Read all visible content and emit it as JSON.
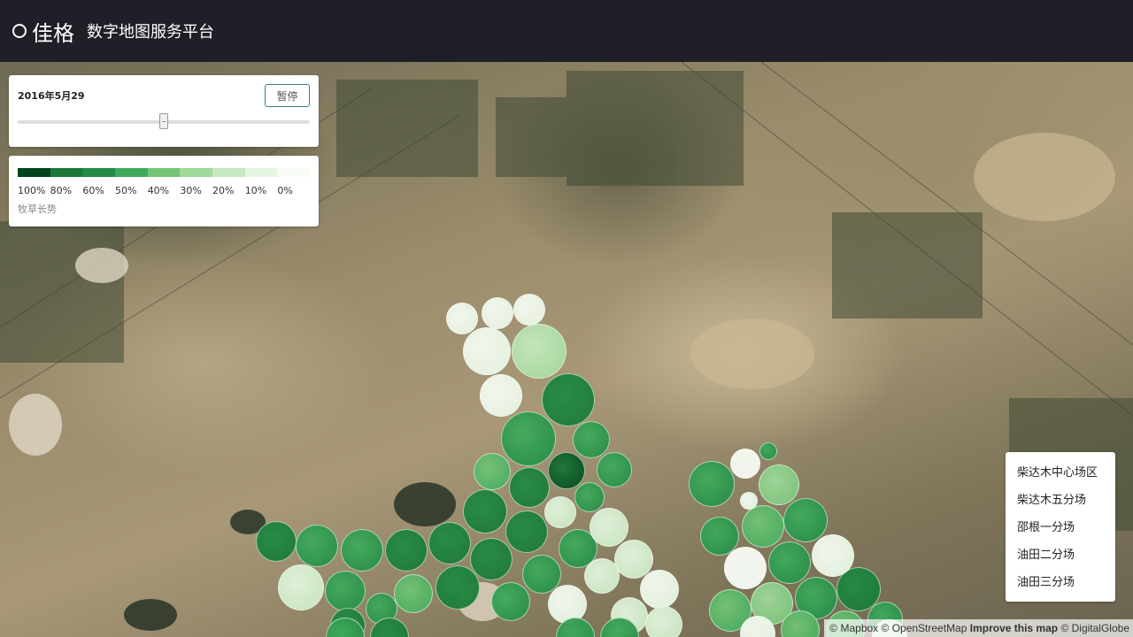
{
  "header": {
    "brand": "佳格",
    "platform_title": "数字地图服务平台"
  },
  "timeline": {
    "date_label": "2016年5月29",
    "pause_label": "暂停",
    "progress": 0.5
  },
  "legend": {
    "colors": [
      "#00441b",
      "#1b7837",
      "#238b45",
      "#41ab5d",
      "#74c476",
      "#a1d99b",
      "#c7e9c0",
      "#e5f5e0",
      "#f7fcf5"
    ],
    "ticks": [
      "100%",
      "80%",
      "60%",
      "50%",
      "40%",
      "30%",
      "20%",
      "10%",
      "0%"
    ],
    "title": "牧草长势"
  },
  "farm_list": {
    "items": [
      "柴达木中心场区",
      "柴达木五分场",
      "邵根一分场",
      "油田二分场",
      "油田三分场"
    ]
  },
  "attribution": {
    "mapbox": "© Mapbox",
    "osm": "© OpenStreetMap",
    "improve": "Improve this map",
    "digitalglobe": "© DigitalGlobe"
  },
  "fields": [
    {
      "level": 0.1
    },
    {
      "level": 0.1
    },
    {
      "level": 0.1
    },
    {
      "level": 0.15
    },
    {
      "level": 0.4
    },
    {
      "level": 0.15
    },
    {
      "level": 0.9
    },
    {
      "level": 0.75
    },
    {
      "level": 0.8
    },
    {
      "level": 0.65
    },
    {
      "level": 0.9
    },
    {
      "level": 0.95
    },
    {
      "level": 0.75
    },
    {
      "level": 0.85
    },
    {
      "level": 0.9
    },
    {
      "level": 0.2
    },
    {
      "level": 0.75
    },
    {
      "level": 0.85
    },
    {
      "level": 0.7
    },
    {
      "level": 0.7
    },
    {
      "level": 0.3
    },
    {
      "level": 0.2
    },
    {
      "level": 0.1
    },
    {
      "level": 0.9
    },
    {
      "level": 0.8
    },
    {
      "level": 0.7
    },
    {
      "level": 0.85
    },
    {
      "level": 0.9
    },
    {
      "level": 0.9
    },
    {
      "level": 0.6
    },
    {
      "level": 0.3
    },
    {
      "level": 0.7
    },
    {
      "level": 0.8
    },
    {
      "level": 0.9
    },
    {
      "level": 0.75
    },
    {
      "level": 0.15
    },
    {
      "level": 0.3
    },
    {
      "level": 0.2
    },
    {
      "level": 0.25
    },
    {
      "level": 0.05
    },
    {
      "level": 0.75
    },
    {
      "level": 0.75
    },
    {
      "level": 0.5
    },
    {
      "level": 0.75
    },
    {
      "level": 0.6
    },
    {
      "level": 0.75
    },
    {
      "level": 0.1
    },
    {
      "level": 0.05
    },
    {
      "level": 0.8
    },
    {
      "level": 0.9
    },
    {
      "level": 0.1
    },
    {
      "level": 0.7
    },
    {
      "level": 0.55
    },
    {
      "level": 0.6
    },
    {
      "level": 0.65
    },
    {
      "level": 0.65
    },
    {
      "level": 0.7
    },
    {
      "level": 0.2
    },
    {
      "level": 0.1
    },
    {
      "level": 0.7
    },
    {
      "level": 0.85
    },
    {
      "level": 0.7
    },
    {
      "level": 0.7
    }
  ]
}
